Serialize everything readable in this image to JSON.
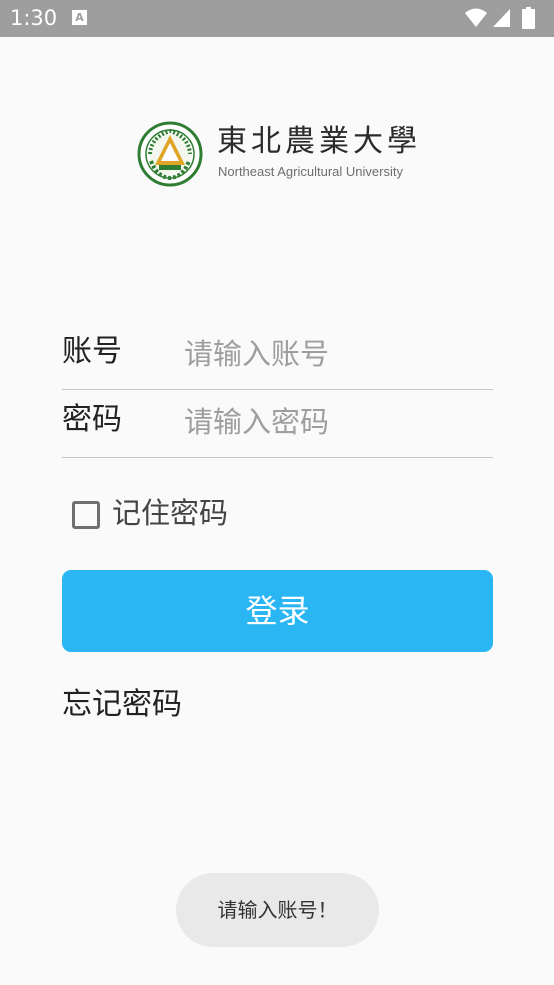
{
  "status_bar": {
    "time": "1:30",
    "notification_icon": "A",
    "icons": [
      "wifi-icon",
      "signal-icon",
      "battery-icon"
    ]
  },
  "logo": {
    "name_cn": "東北農業大學",
    "name_en": "Northeast Agricultural University",
    "emblem_icon": "university-emblem-icon"
  },
  "form": {
    "account": {
      "label": "账号",
      "value": "",
      "placeholder": "请输入账号"
    },
    "password": {
      "label": "密码",
      "value": "",
      "placeholder": "请输入密码"
    },
    "remember": {
      "label": "记住密码",
      "checked": false
    },
    "login_label": "登录",
    "forgot_label": "忘记密码"
  },
  "toast": {
    "message": "请输入账号！"
  },
  "colors": {
    "status_bar": "#9e9e9e",
    "background": "#fafafa",
    "primary_button": "#29b6f3",
    "emblem_green": "#2e7d32",
    "emblem_gold": "#e0a526"
  }
}
